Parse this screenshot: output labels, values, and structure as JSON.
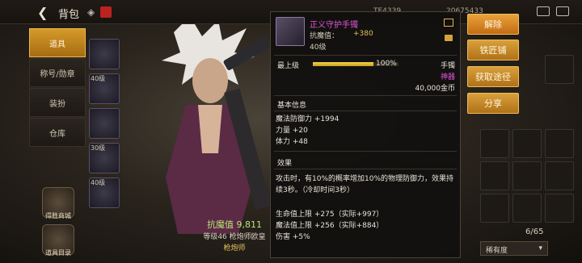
{
  "header": {
    "title": "背包",
    "currency_1": "TE4339",
    "currency_2": "20675433"
  },
  "tabs": [
    {
      "label": "道具",
      "active": true
    },
    {
      "label": "称号/勋章",
      "active": false
    },
    {
      "label": "装扮",
      "active": false
    },
    {
      "label": "仓库",
      "active": false
    }
  ],
  "side_buttons": [
    {
      "label": "得胜商城"
    },
    {
      "label": "道具目录"
    }
  ],
  "slots": [
    {
      "level": ""
    },
    {
      "level": "40级"
    },
    {
      "level": ""
    },
    {
      "level": "30级"
    },
    {
      "level": "40级"
    }
  ],
  "character": {
    "resist_line": "抗魔值 9,811",
    "sub_line": "等级46 枪炮师欧皇",
    "job": "枪炮师"
  },
  "inventory": {
    "count": "6/65",
    "sort_label": "稀有度"
  },
  "tooltip": {
    "name": "正义守护手镯",
    "resist_label": "抗魔值：",
    "resist_value": "+380",
    "level": "40级",
    "max_label": "最上级",
    "progress_pct": "100%",
    "progress_fraction": 1.0,
    "type": "手镯",
    "rarity": "神器",
    "price": "40,000金币",
    "base_title": "基本信息",
    "base_lines": [
      "魔法防御力 +1994",
      "力量 +20",
      "体力 +48"
    ],
    "effect_title": "效果",
    "effect_lines": [
      "攻击时，有10%的概率增加10%的物理防御力，效果持",
      "续3秒。（冷却时间3秒）",
      "",
      "生命值上限 +275（实际+997）",
      "魔法值上限 +256（实际+884）",
      "伤害 +5%"
    ]
  },
  "actions": {
    "dismantle": "解除",
    "smith": "铁匠铺",
    "source": "获取途径",
    "share": "分享"
  }
}
